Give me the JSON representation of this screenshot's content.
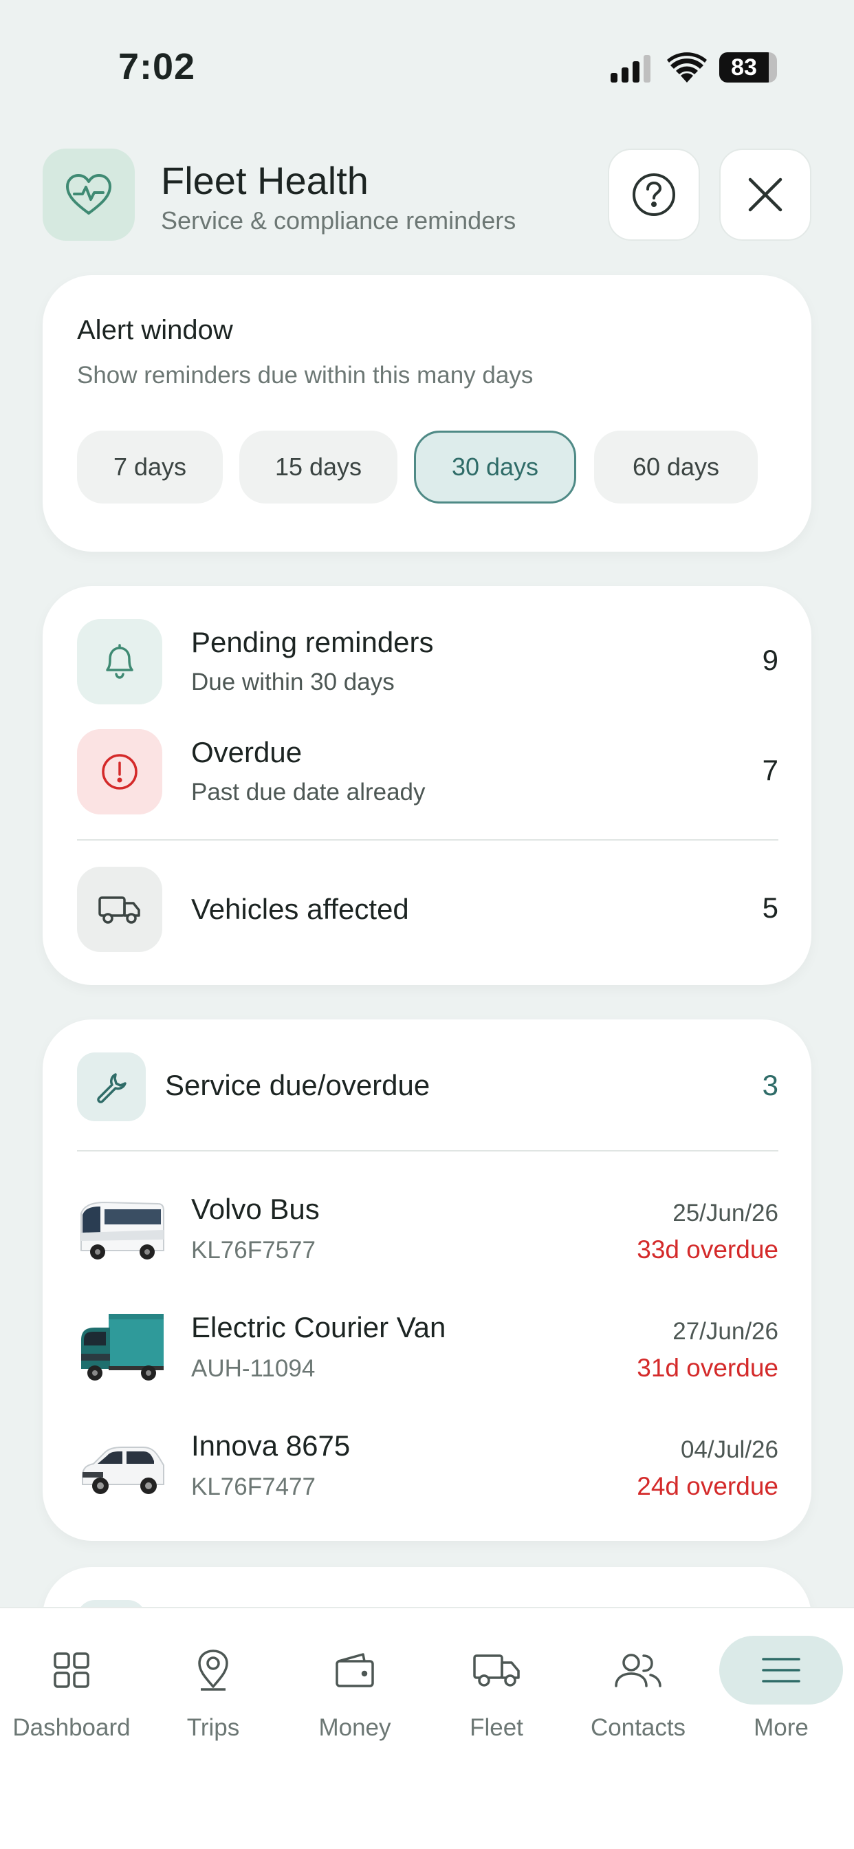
{
  "status_bar": {
    "time": "7:02",
    "battery": "83"
  },
  "header": {
    "title": "Fleet Health",
    "subtitle": "Service & compliance reminders",
    "icon": "heart-pulse-icon",
    "help_icon": "question-circle-icon",
    "close_icon": "close-icon"
  },
  "alert_window": {
    "title": "Alert window",
    "subtitle": "Show reminders due within this many days",
    "options": [
      "7 days",
      "15 days",
      "30 days",
      "60 days"
    ],
    "selected": "30 days"
  },
  "summary": {
    "pending": {
      "title": "Pending reminders",
      "subtitle": "Due within 30 days",
      "count": "9",
      "icon": "bell-icon"
    },
    "overdue": {
      "title": "Overdue",
      "subtitle": "Past due date already",
      "count": "7",
      "icon": "alert-circle-icon"
    },
    "vehicles": {
      "title": "Vehicles affected",
      "count": "5",
      "icon": "truck-icon"
    }
  },
  "service": {
    "title": "Service due/overdue",
    "count": "3",
    "icon": "wrench-icon",
    "vehicles": [
      {
        "name": "Volvo Bus",
        "plate": "KL76F7577",
        "date": "25/Jun/26",
        "status": "33d overdue"
      },
      {
        "name": "Electric Courier Van",
        "plate": "AUH-11094",
        "date": "27/Jun/26",
        "status": "31d overdue"
      },
      {
        "name": "Innova 8675",
        "plate": "KL76F7477",
        "date": "04/Jul/26",
        "status": "24d overdue"
      }
    ]
  },
  "nav": {
    "items": [
      {
        "label": "Dashboard",
        "icon": "grid-icon"
      },
      {
        "label": "Trips",
        "icon": "map-pin-icon"
      },
      {
        "label": "Money",
        "icon": "wallet-icon"
      },
      {
        "label": "Fleet",
        "icon": "truck-icon"
      },
      {
        "label": "Contacts",
        "icon": "users-icon"
      },
      {
        "label": "More",
        "icon": "menu-icon"
      }
    ],
    "active": "More"
  },
  "colors": {
    "accent": "#2f6c68",
    "danger": "#d42a2a",
    "background": "#edf2f1"
  }
}
